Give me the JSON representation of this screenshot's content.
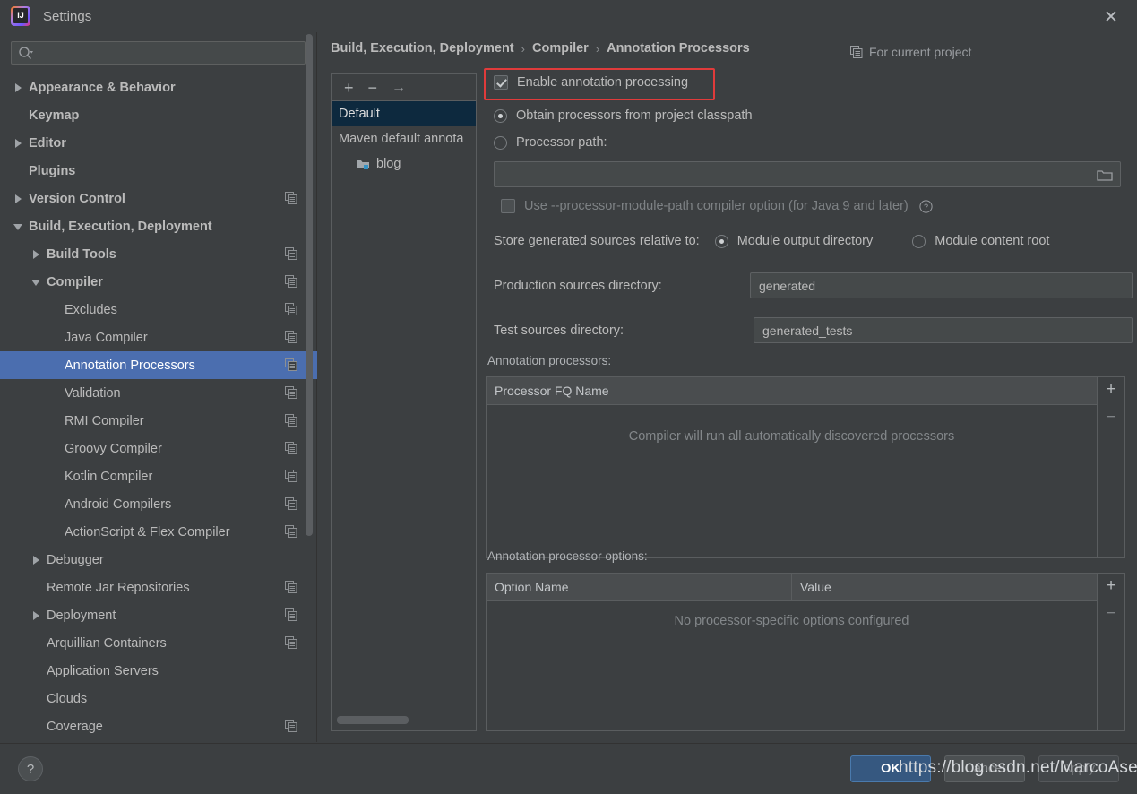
{
  "window": {
    "title": "Settings",
    "logo_icon": "intellij-idea-logo",
    "close_icon": "close-icon"
  },
  "sidebar": {
    "search": {
      "placeholder": "",
      "value": "",
      "icon": "search-icon"
    },
    "items": [
      {
        "label": "Appearance & Behavior",
        "indent": 0,
        "twisty": "closed",
        "bold": true,
        "copy": false,
        "selected": false
      },
      {
        "label": "Keymap",
        "indent": 0,
        "twisty": "none",
        "bold": true,
        "copy": false,
        "selected": false
      },
      {
        "label": "Editor",
        "indent": 0,
        "twisty": "closed",
        "bold": true,
        "copy": false,
        "selected": false
      },
      {
        "label": "Plugins",
        "indent": 0,
        "twisty": "none",
        "bold": true,
        "copy": false,
        "selected": false
      },
      {
        "label": "Version Control",
        "indent": 0,
        "twisty": "closed",
        "bold": true,
        "copy": true,
        "selected": false
      },
      {
        "label": "Build, Execution, Deployment",
        "indent": 0,
        "twisty": "open",
        "bold": true,
        "copy": false,
        "selected": false
      },
      {
        "label": "Build Tools",
        "indent": 1,
        "twisty": "closed",
        "bold": true,
        "copy": true,
        "selected": false
      },
      {
        "label": "Compiler",
        "indent": 1,
        "twisty": "open",
        "bold": true,
        "copy": true,
        "selected": false
      },
      {
        "label": "Excludes",
        "indent": 2,
        "twisty": "none",
        "bold": false,
        "copy": true,
        "selected": false
      },
      {
        "label": "Java Compiler",
        "indent": 2,
        "twisty": "none",
        "bold": false,
        "copy": true,
        "selected": false
      },
      {
        "label": "Annotation Processors",
        "indent": 2,
        "twisty": "none",
        "bold": false,
        "copy": true,
        "selected": true
      },
      {
        "label": "Validation",
        "indent": 2,
        "twisty": "none",
        "bold": false,
        "copy": true,
        "selected": false
      },
      {
        "label": "RMI Compiler",
        "indent": 2,
        "twisty": "none",
        "bold": false,
        "copy": true,
        "selected": false
      },
      {
        "label": "Groovy Compiler",
        "indent": 2,
        "twisty": "none",
        "bold": false,
        "copy": true,
        "selected": false
      },
      {
        "label": "Kotlin Compiler",
        "indent": 2,
        "twisty": "none",
        "bold": false,
        "copy": true,
        "selected": false
      },
      {
        "label": "Android Compilers",
        "indent": 2,
        "twisty": "none",
        "bold": false,
        "copy": true,
        "selected": false
      },
      {
        "label": "ActionScript & Flex Compiler",
        "indent": 2,
        "twisty": "none",
        "bold": false,
        "copy": true,
        "selected": false
      },
      {
        "label": "Debugger",
        "indent": 1,
        "twisty": "closed",
        "bold": false,
        "copy": false,
        "selected": false
      },
      {
        "label": "Remote Jar Repositories",
        "indent": 1,
        "twisty": "none",
        "bold": false,
        "copy": true,
        "selected": false
      },
      {
        "label": "Deployment",
        "indent": 1,
        "twisty": "closed",
        "bold": false,
        "copy": true,
        "selected": false
      },
      {
        "label": "Arquillian Containers",
        "indent": 1,
        "twisty": "none",
        "bold": false,
        "copy": true,
        "selected": false
      },
      {
        "label": "Application Servers",
        "indent": 1,
        "twisty": "none",
        "bold": false,
        "copy": false,
        "selected": false
      },
      {
        "label": "Clouds",
        "indent": 1,
        "twisty": "none",
        "bold": false,
        "copy": false,
        "selected": false
      },
      {
        "label": "Coverage",
        "indent": 1,
        "twisty": "none",
        "bold": false,
        "copy": true,
        "selected": false
      }
    ]
  },
  "main": {
    "breadcrumb": {
      "part1": "Build, Execution, Deployment",
      "sep1": "›",
      "part2": "Compiler",
      "sep2": "›",
      "part3": "Annotation Processors"
    },
    "for_current_project": {
      "label": "For current project",
      "icon": "copy-icon"
    },
    "profiles": {
      "toolbar": {
        "add": "+",
        "remove": "−",
        "move": "→"
      },
      "rows": [
        {
          "label": "Default",
          "selected": true,
          "child": false
        },
        {
          "label": "Maven default annota",
          "selected": false,
          "child": false
        },
        {
          "label": "blog",
          "selected": false,
          "child": true,
          "icon": "module-icon"
        }
      ]
    },
    "enable_annotation_processing": {
      "label": "Enable annotation processing",
      "checked": true,
      "highlight_color": "#e03b3b"
    },
    "processor_source": {
      "option_classpath": {
        "label": "Obtain processors from project classpath",
        "selected": true
      },
      "option_path": {
        "label": "Processor path:",
        "selected": false
      },
      "path_value": "",
      "browse_icon": "folder-icon"
    },
    "module_path_option": {
      "label": "Use --processor-module-path compiler option (for Java 9 and later)",
      "checked": false,
      "help_icon": "question-circle-icon"
    },
    "store_relative": {
      "label": "Store generated sources relative to:",
      "option_output": {
        "label": "Module output directory",
        "selected": true
      },
      "option_content": {
        "label": "Module content root",
        "selected": false
      }
    },
    "production_sources": {
      "label": "Production sources directory:",
      "value": "generated"
    },
    "test_sources": {
      "label": "Test sources directory:",
      "value": "generated_tests"
    },
    "processors_table": {
      "caption": "Annotation processors:",
      "columns": [
        "Processor FQ Name"
      ],
      "rows": [],
      "empty_text": "Compiler will run all automatically discovered processors",
      "add": "+",
      "remove": "−"
    },
    "options_table": {
      "caption": "Annotation processor options:",
      "columns": [
        "Option Name",
        "Value"
      ],
      "rows": [],
      "empty_text": "No processor-specific options configured",
      "add": "+",
      "remove": "−"
    }
  },
  "footer": {
    "help": "?",
    "ok": "OK",
    "cancel": "Cancel",
    "apply": "Apply"
  },
  "watermark": "https://blog.csdn.net/MarcoAsensio"
}
